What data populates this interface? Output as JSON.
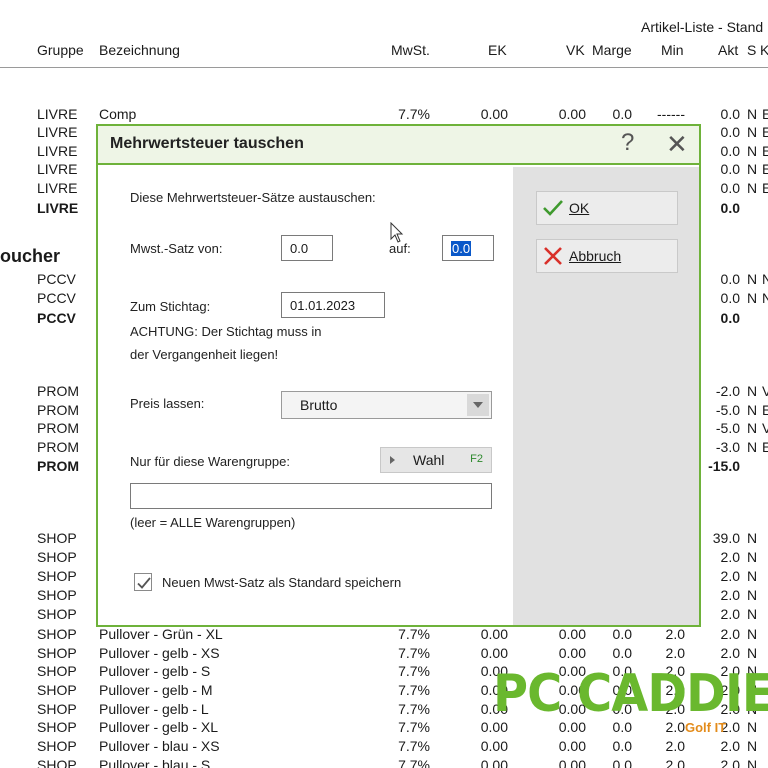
{
  "list": {
    "title": "Artikel-Liste - Stand",
    "headers": {
      "gruppe": "Gruppe",
      "bezeichnung": "Bezeichnung",
      "mwst": "MwSt.",
      "ek": "EK",
      "vk": "VK",
      "marge": "Marge",
      "min": "Min",
      "akt": "Akt",
      "s": "S",
      "k": "K"
    },
    "section_label": "oucher",
    "rows": [
      {
        "g": "LIVRE",
        "b": "Comp",
        "m": "7.7%",
        "ek": "0.00",
        "vk": "0.00",
        "ma": "0.0",
        "mi": "------",
        "ak": "0.0",
        "s": "N",
        "k": "E"
      },
      {
        "g": "LIVRE",
        "ak": "0.0",
        "s": "N",
        "k": "E"
      },
      {
        "g": "LIVRE",
        "ak": "0.0",
        "s": "N",
        "k": "E"
      },
      {
        "g": "LIVRE",
        "ak": "0.0",
        "s": "N",
        "k": "E"
      },
      {
        "g": "LIVRE",
        "ak": "0.0",
        "s": "N",
        "k": "E"
      },
      {
        "g": "LIVRE",
        "ak": "0.0",
        "bold": true
      },
      {
        "g": "PCCV",
        "ak": "0.0",
        "s": "N",
        "k": "N"
      },
      {
        "g": "PCCV",
        "ak": "0.0",
        "s": "N",
        "k": "N"
      },
      {
        "g": "PCCV",
        "ak": "0.0",
        "bold": true
      },
      {
        "g": "PROM",
        "ak": "-2.0",
        "s": "N",
        "k": "V"
      },
      {
        "g": "PROM",
        "ak": "-5.0",
        "s": "N",
        "k": "E"
      },
      {
        "g": "PROM",
        "ak": "-5.0",
        "s": "N",
        "k": "V"
      },
      {
        "g": "PROM",
        "ak": "-3.0",
        "s": "N",
        "k": "E"
      },
      {
        "g": "PROM",
        "ak": "-15.0",
        "bold": true
      },
      {
        "g": "SHOP",
        "ak": "39.0",
        "s": "N"
      },
      {
        "g": "SHOP",
        "ak": "2.0",
        "s": "N"
      },
      {
        "g": "SHOP",
        "ak": "2.0",
        "s": "N"
      },
      {
        "g": "SHOP",
        "ak": "2.0",
        "s": "N"
      },
      {
        "g": "SHOP",
        "ak": "2.0",
        "s": "N"
      },
      {
        "g": "SHOP",
        "b": "Pullover - Grün - XL",
        "m": "7.7%",
        "ek": "0.00",
        "vk": "0.00",
        "ma": "0.0",
        "mi": "2.0",
        "ak": "2.0",
        "s": "N"
      },
      {
        "g": "SHOP",
        "b": "Pullover - gelb - XS",
        "m": "7.7%",
        "ek": "0.00",
        "vk": "0.00",
        "ma": "0.0",
        "mi": "2.0",
        "ak": "2.0",
        "s": "N"
      },
      {
        "g": "SHOP",
        "b": "Pullover - gelb - S",
        "m": "7.7%",
        "ek": "0.00",
        "vk": "0.00",
        "ma": "0.0",
        "mi": "2.0",
        "ak": "2.0",
        "s": "N"
      },
      {
        "g": "SHOP",
        "b": "Pullover - gelb - M",
        "m": "7.7%",
        "ek": "0.00",
        "vk": "0.00",
        "ma": "0.0",
        "mi": "2.0",
        "ak": "2.0",
        "s": "N"
      },
      {
        "g": "SHOP",
        "b": "Pullover - gelb - L",
        "m": "7.7%",
        "ek": "0.00",
        "vk": "0.00",
        "ma": "0.0",
        "mi": "2.0",
        "ak": "2.0",
        "s": "N"
      },
      {
        "g": "SHOP",
        "b": "Pullover - gelb - XL",
        "m": "7.7%",
        "ek": "0.00",
        "vk": "0.00",
        "ma": "0.0",
        "mi": "2.0",
        "ak": "2.0",
        "s": "N"
      },
      {
        "g": "SHOP",
        "b": "Pullover - blau - XS",
        "m": "7.7%",
        "ek": "0.00",
        "vk": "0.00",
        "ma": "0.0",
        "mi": "2.0",
        "ak": "2.0",
        "s": "N"
      },
      {
        "g": "SHOP",
        "b": "Pullover - blau - S",
        "m": "7.7%",
        "ek": "0.00",
        "vk": "0.00",
        "ma": "0.0",
        "mi": "2.0",
        "ak": "2.0",
        "s": "N"
      }
    ]
  },
  "dialog": {
    "title": "Mehrwertsteuer tauschen",
    "help_glyph": "?",
    "close_glyph": "✕",
    "intro": "Diese Mehrwertsteuer-Sätze austauschen:",
    "rate_from_label": "Mwst.-Satz von:",
    "rate_from_value": "0.0",
    "rate_to_label": "auf:",
    "rate_to_value": "0.0",
    "date_label": "Zum Stichtag:",
    "date_value": "01.01.2023",
    "warning_line1": "ACHTUNG: Der Stichtag muss in",
    "warning_line2": "der Vergangenheit liegen!",
    "price_label": "Preis lassen:",
    "price_value": "Brutto",
    "group_label": "Nur für diese Warengruppe:",
    "wahl_label": "Wahl",
    "wahl_key": "F2",
    "group_value": "",
    "group_hint": "(leer = ALLE Warengruppen)",
    "save_default_label": "Neuen Mwst-Satz als Standard speichern",
    "save_default_checked": true,
    "ok_label": "OK",
    "cancel_label": "Abbruch"
  },
  "logo": {
    "main": "PC CADDIE",
    "sub": "Golf IT",
    "color": "#6ab82e",
    "sub_color": "#e38b1a"
  },
  "colors": {
    "dialog_border": "#6eb23a",
    "selection": "#0a58c9",
    "ok_check": "#3f9a2e",
    "cancel_x": "#d9302a"
  }
}
